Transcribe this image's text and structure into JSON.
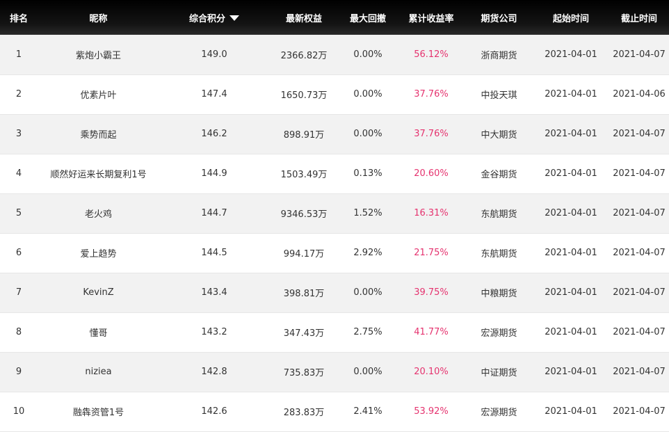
{
  "colors": {
    "header_bg": "#000000",
    "return_rate": "#e5336f",
    "row_alt": "#f2f2f2"
  },
  "headers": {
    "rank": "排名",
    "nickname": "昵称",
    "score": "综合积分",
    "equity": "最新权益",
    "drawdown": "最大回撤",
    "return": "累计收益率",
    "broker": "期货公司",
    "start": "起始时间",
    "end": "截止时间"
  },
  "sort": {
    "column": "score",
    "direction": "desc",
    "icon": "sort-down-icon"
  },
  "rows": [
    {
      "rank": "1",
      "nickname": "紫炮小霸王",
      "score": "149.0",
      "equity": "2366.82万",
      "drawdown": "0.00%",
      "return": "56.12%",
      "broker": "浙商期货",
      "start": "2021-04-01",
      "end": "2021-04-07"
    },
    {
      "rank": "2",
      "nickname": "优素片叶",
      "score": "147.4",
      "equity": "1650.73万",
      "drawdown": "0.00%",
      "return": "37.76%",
      "broker": "中投天琪",
      "start": "2021-04-01",
      "end": "2021-04-06"
    },
    {
      "rank": "3",
      "nickname": "乘势而起",
      "score": "146.2",
      "equity": "898.91万",
      "drawdown": "0.00%",
      "return": "37.76%",
      "broker": "中大期货",
      "start": "2021-04-01",
      "end": "2021-04-07"
    },
    {
      "rank": "4",
      "nickname": "顺然好运来长期复利1号",
      "score": "144.9",
      "equity": "1503.49万",
      "drawdown": "0.13%",
      "return": "20.60%",
      "broker": "金谷期货",
      "start": "2021-04-01",
      "end": "2021-04-07"
    },
    {
      "rank": "5",
      "nickname": "老火鸡",
      "score": "144.7",
      "equity": "9346.53万",
      "drawdown": "1.52%",
      "return": "16.31%",
      "broker": "东航期货",
      "start": "2021-04-01",
      "end": "2021-04-07"
    },
    {
      "rank": "6",
      "nickname": "爱上趋势",
      "score": "144.5",
      "equity": "994.17万",
      "drawdown": "2.92%",
      "return": "21.75%",
      "broker": "东航期货",
      "start": "2021-04-01",
      "end": "2021-04-07"
    },
    {
      "rank": "7",
      "nickname": "KevinZ",
      "score": "143.4",
      "equity": "398.81万",
      "drawdown": "0.00%",
      "return": "39.75%",
      "broker": "中粮期货",
      "start": "2021-04-01",
      "end": "2021-04-07"
    },
    {
      "rank": "8",
      "nickname": "懂哥",
      "score": "143.2",
      "equity": "347.43万",
      "drawdown": "2.75%",
      "return": "41.77%",
      "broker": "宏源期货",
      "start": "2021-04-01",
      "end": "2021-04-07"
    },
    {
      "rank": "9",
      "nickname": "niziea",
      "score": "142.8",
      "equity": "735.83万",
      "drawdown": "0.00%",
      "return": "20.10%",
      "broker": "中证期货",
      "start": "2021-04-01",
      "end": "2021-04-07"
    },
    {
      "rank": "10",
      "nickname": "融犇资管1号",
      "score": "142.6",
      "equity": "283.83万",
      "drawdown": "2.41%",
      "return": "53.92%",
      "broker": "宏源期货",
      "start": "2021-04-01",
      "end": "2021-04-07"
    }
  ]
}
